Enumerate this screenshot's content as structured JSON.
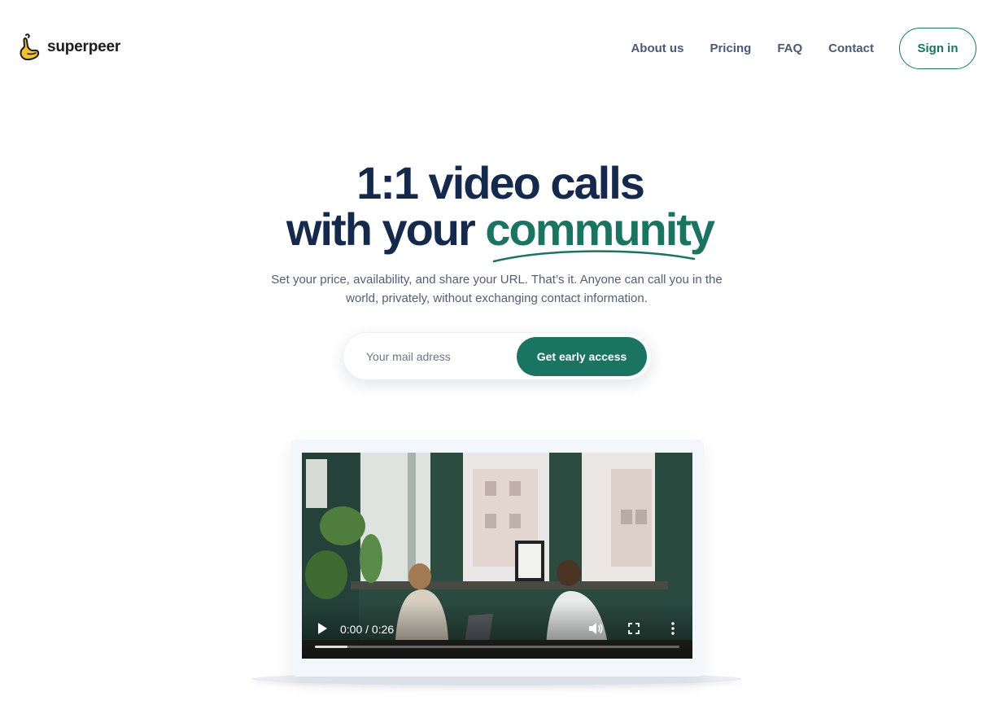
{
  "brand": {
    "name": "superpeer",
    "logo_icon": "hand-logo-icon",
    "accent_color": "#1a7461",
    "logo_color": "#f5c12e"
  },
  "nav": {
    "links": [
      "About us",
      "Pricing",
      "FAQ",
      "Contact"
    ],
    "signin_label": "Sign in"
  },
  "hero": {
    "title_line1": "1:1 video calls",
    "title_line2_prefix": "with your ",
    "title_line2_accent": "community",
    "subtitle": "Set your price, availability, and share your URL. That’s it. Anyone can call you in the world, privately, without exchanging contact information."
  },
  "signup": {
    "email_placeholder": "Your mail adress",
    "email_value": "",
    "cta_label": "Get early access"
  },
  "video": {
    "time": "0:00 / 0:26",
    "progress": 0.09,
    "icons": [
      "play-icon",
      "volume-icon",
      "fullscreen-icon",
      "more-options-icon"
    ]
  }
}
